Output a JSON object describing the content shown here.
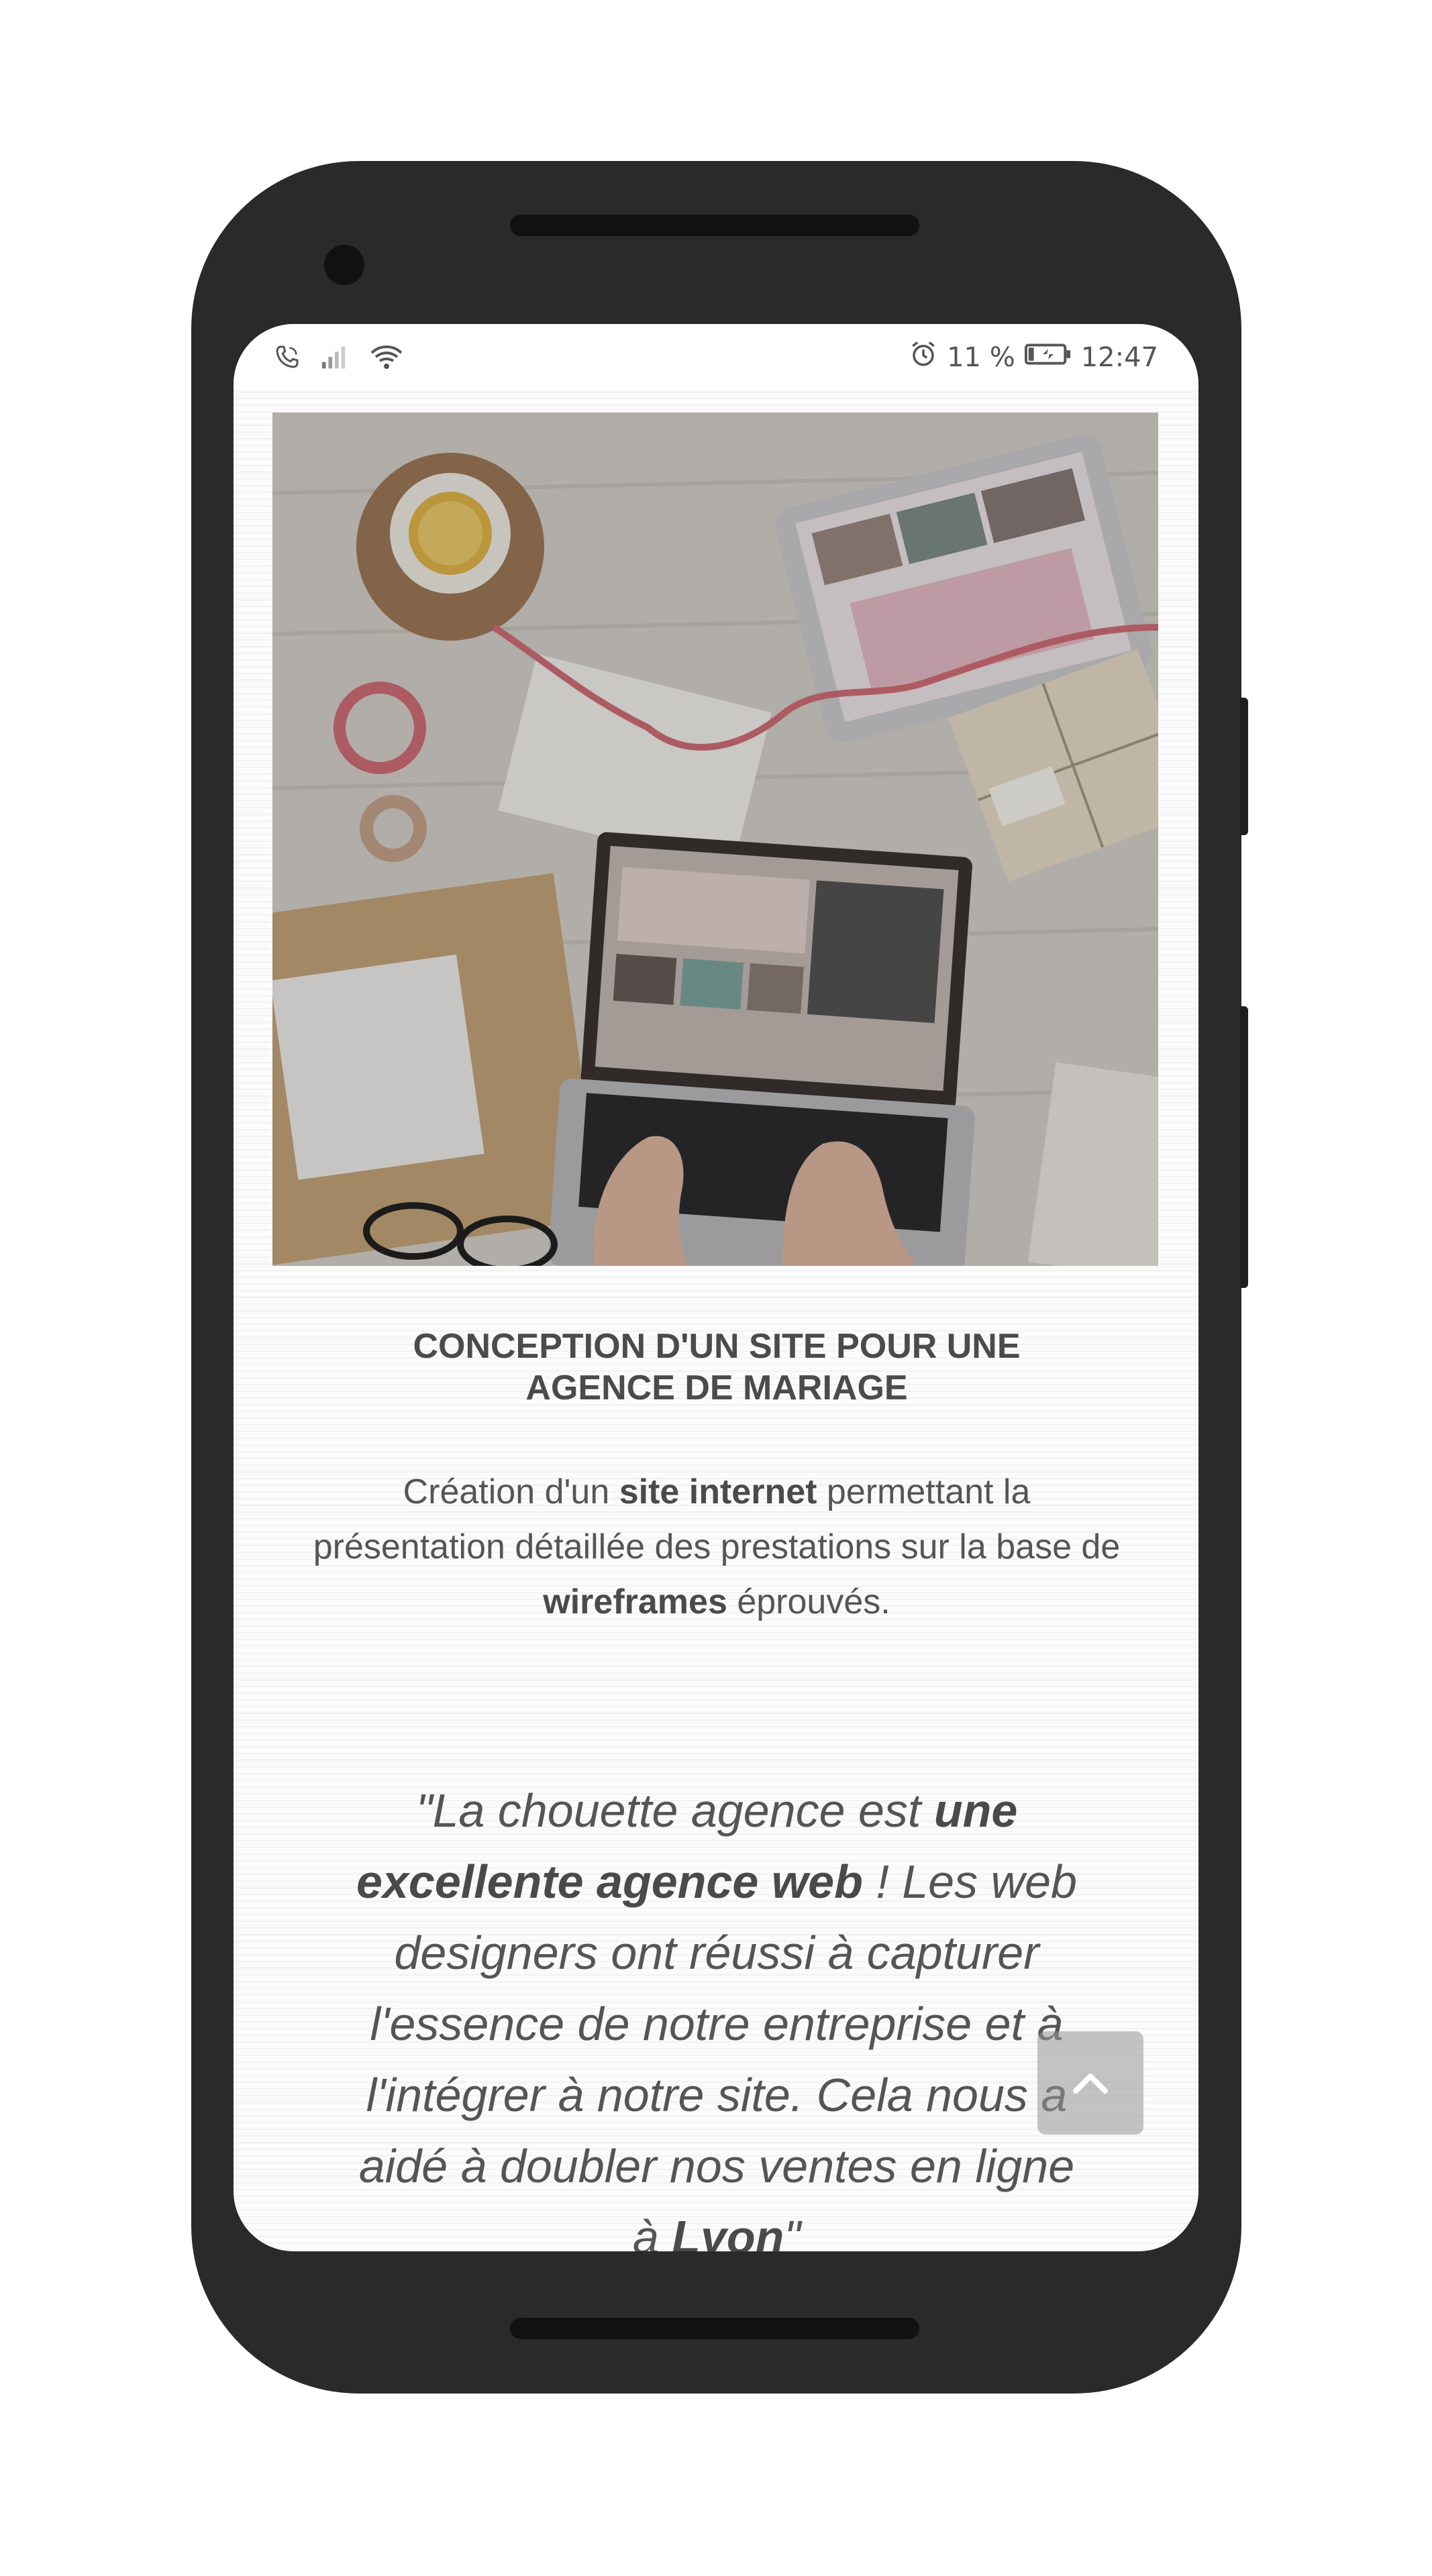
{
  "status_bar": {
    "battery": "11 %",
    "time": "12:47",
    "icons": [
      "phone-call-icon",
      "signal-icon",
      "wifi-icon",
      "alarm-icon",
      "battery-icon"
    ]
  },
  "hero": {
    "alt": "Photo d'un bureau avec ordinateur portable"
  },
  "project": {
    "title_line1": "CONCEPTION D'UN SITE POUR UNE",
    "title_line2": "AGENCE DE MARIAGE",
    "desc_part1": "Création d'un ",
    "desc_bold1": "site internet",
    "desc_part2": " permettant la présentation détaillée des prestations sur la base de ",
    "desc_bold2": "wireframes",
    "desc_part3": " éprouvés."
  },
  "testimonial": {
    "part1": "\"La chouette agence est ",
    "bold1": "une excellente agence web",
    "part2": " ! Les web designers ont réussi à capturer l'essence de notre entreprise et à l'intégrer à notre site. Cela nous a aidé à doubler nos ventes en ligne à ",
    "bold2": "Lyon",
    "part3": "\""
  },
  "scroll_top": {
    "icon": "chevron-up-icon"
  }
}
